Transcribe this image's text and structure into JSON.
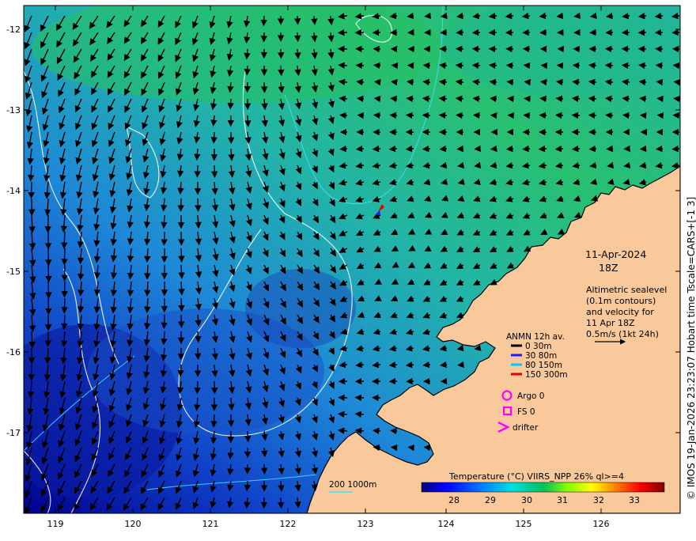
{
  "map": {
    "date": "11-Apr-2024",
    "time": "18Z",
    "lon_ticks": [
      "119",
      "120",
      "121",
      "122",
      "123",
      "124",
      "125",
      "126"
    ],
    "lat_ticks": [
      "-12",
      "-13",
      "-14",
      "-15",
      "-16",
      "-17"
    ],
    "info_lines": [
      "Altimetric sealevel",
      "(0.1m contours)",
      "and velocity for",
      "11 Apr 18Z",
      "0.5m/s (1kt 24h)"
    ],
    "anmn": {
      "title": "ANMN 12h av.",
      "items": [
        {
          "label": "0 30m",
          "color": "#000000"
        },
        {
          "label": "30 80m",
          "color": "#1a1aff"
        },
        {
          "label": "80 150m",
          "color": "#00c8ff"
        },
        {
          "label": "150 300m",
          "color": "#e00000"
        }
      ]
    },
    "argo_label": "Argo 0",
    "fs_label": "FS 0",
    "drifter_label": "drifter",
    "marker_color": "#ff00ff",
    "depth_label": "200  1000m",
    "colorbar": {
      "title": "Temperature (°C) VIIRS_NPP 26% ql>=4",
      "ticks": [
        "28",
        "29",
        "30",
        "31",
        "32",
        "33"
      ]
    },
    "credit": "© IMOS 19-Jan-2026 23:23:07 Hobart time Tscale=CARS+[-1 3]",
    "land_color": "#f9c99c",
    "coast_color": "#000000"
  }
}
